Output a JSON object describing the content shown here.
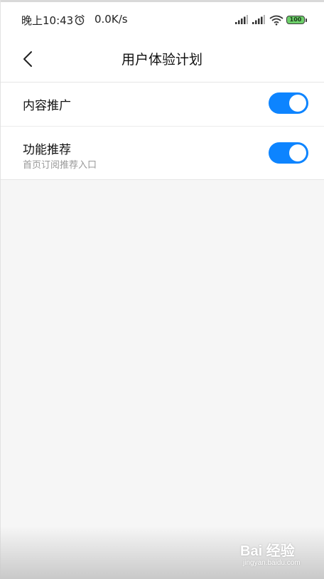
{
  "status_bar": {
    "time": "晚上10:43",
    "net_speed": "0.0K/s",
    "battery_level": "100",
    "icons": [
      "alarm-icon",
      "signal-icon",
      "signal-icon",
      "wifi-icon",
      "battery-icon"
    ]
  },
  "header": {
    "back_icon": "chevron-left-icon",
    "title": "用户体验计划"
  },
  "settings": {
    "items": [
      {
        "title": "内容推广",
        "subtitle": "",
        "enabled": true
      },
      {
        "title": "功能推荐",
        "subtitle": "首页订阅推荐入口",
        "enabled": true
      }
    ]
  },
  "watermark": {
    "brand": "Bai 经验",
    "url": "jingyan.baidu.com"
  },
  "colors": {
    "accent": "#0d84ff",
    "background": "#f6f6f6",
    "battery": "#6dd06a"
  }
}
